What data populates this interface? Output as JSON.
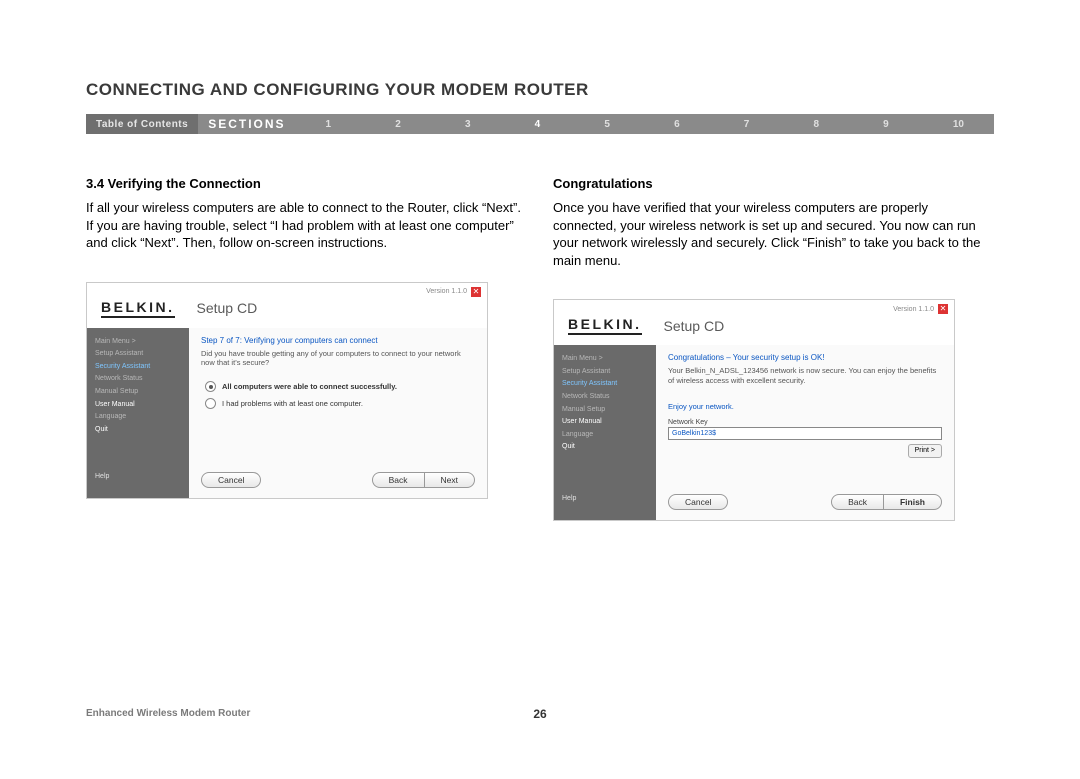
{
  "page_title": "CONNECTING AND CONFIGURING YOUR MODEM ROUTER",
  "nav": {
    "toc": "Table of Contents",
    "sections_label": "SECTIONS",
    "items": [
      "1",
      "2",
      "3",
      "4",
      "5",
      "6",
      "7",
      "8",
      "9",
      "10"
    ],
    "current": "4"
  },
  "left": {
    "heading": "3.4 Verifying the Connection",
    "body": "If all your wireless computers are able to connect to the Router, click “Next”. If you are having trouble, select “I had problem with at least one computer” and click “Next”. Then, follow on-screen instructions."
  },
  "right": {
    "heading": "Congratulations",
    "body": "Once you have verified that your wireless computers are properly connected, your wireless network is set up and secured. You now can run your network wirelessly and securely. Click “Finish” to take you back to the main menu."
  },
  "panel_common": {
    "version": "Version 1.1.0",
    "logo": "BELKIN.",
    "title": "Setup CD",
    "menu": {
      "main": "Main Menu  >",
      "setup_assistant": "Setup Assistant",
      "security_assistant": "Security Assistant",
      "network_status": "Network Status",
      "manual_setup": "Manual Setup",
      "user_manual": "User Manual",
      "language": "Language",
      "quit": "Quit",
      "help": "Help"
    },
    "buttons": {
      "cancel": "Cancel",
      "back": "Back",
      "next": "Next",
      "finish": "Finish",
      "print": "Print >"
    }
  },
  "panel_left": {
    "step_title": "Step 7 of 7: Verifying your computers can connect",
    "step_sub": "Did you have trouble getting any of your computers to connect to your network now that it’s secure?",
    "opt1": "All computers were able to connect successfully.",
    "opt2": "I had problems with at least one computer."
  },
  "panel_right": {
    "step_title": "Congratulations – Your security setup is OK!",
    "step_sub": "Your Belkin_N_ADSL_123456 network is now secure. You can enjoy the benefits of wireless access with excellent security.",
    "enjoy": "Enjoy your network.",
    "key_label": "Network Key",
    "key_value": "GoBelkin123$"
  },
  "footer": {
    "product": "Enhanced Wireless Modem Router",
    "page_num": "26"
  }
}
